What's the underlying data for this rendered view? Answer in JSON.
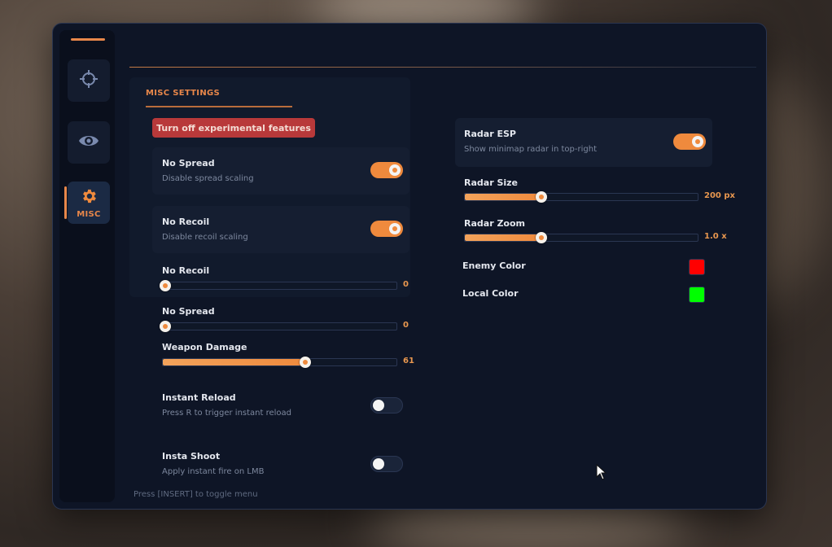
{
  "sidebar": {
    "items": [
      {
        "icon": "crosshair-icon",
        "label": ""
      },
      {
        "icon": "eye-icon",
        "label": ""
      },
      {
        "icon": "gear-icon",
        "label": "MISC",
        "active": true
      }
    ]
  },
  "section": {
    "title": "MISC SETTINGS"
  },
  "warning_button": {
    "label": "Turn off experimental features",
    "color": "#b8393a"
  },
  "left": {
    "no_spread_toggle": {
      "label": "No Spread",
      "desc": "Disable spread scaling",
      "on": true
    },
    "no_recoil_toggle": {
      "label": "No Recoil",
      "desc": "Disable recoil scaling",
      "on": true
    },
    "no_recoil_slider": {
      "label": "No Recoil",
      "value": "0",
      "fraction": 0.0
    },
    "no_spread_slider": {
      "label": "No Spread",
      "value": "0",
      "fraction": 0.0
    },
    "weapon_damage_slider": {
      "label": "Weapon Damage",
      "value": "61",
      "fraction": 0.61
    },
    "instant_reload": {
      "label": "Instant Reload",
      "desc": "Press R to trigger instant reload",
      "on": false
    },
    "insta_shoot": {
      "label": "Insta Shoot",
      "desc": "Apply instant fire on LMB",
      "on": false
    }
  },
  "right": {
    "radar_esp": {
      "label": "Radar ESP",
      "desc": "Show minimap radar in top-right",
      "on": true
    },
    "radar_size": {
      "label": "Radar Size",
      "value": "200 px",
      "fraction": 0.33
    },
    "radar_zoom": {
      "label": "Radar Zoom",
      "value": "1.0 x",
      "fraction": 0.33
    },
    "enemy_color": {
      "label": "Enemy Color",
      "color": "#ff0000"
    },
    "local_color": {
      "label": "Local Color",
      "color": "#00ff00"
    }
  },
  "footer": {
    "hint": "Press [INSERT] to toggle menu"
  },
  "colors": {
    "accent": "#ef8a3d",
    "panel": "#0e1526"
  }
}
